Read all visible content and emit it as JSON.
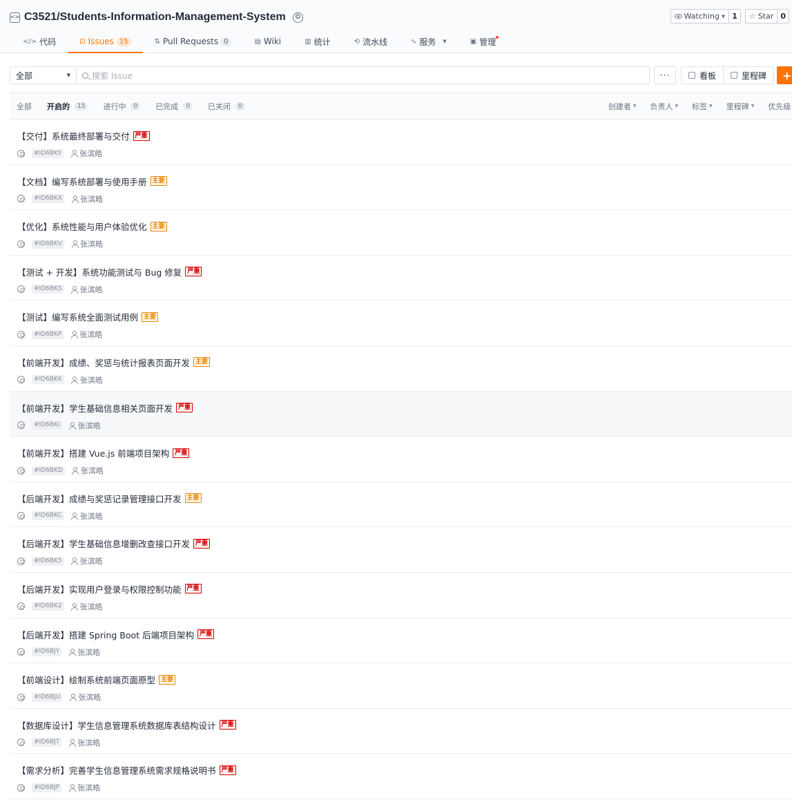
{
  "repo": {
    "title": "C3521/Students-Information-Management-System",
    "repo_icon_glyph": "<>",
    "award_icon_glyph": "✪",
    "watch": {
      "label": "Watching",
      "count": "1"
    },
    "star": {
      "label": "Star",
      "count": "0"
    }
  },
  "tabs": [
    {
      "label": "代码",
      "icon": "code-icon",
      "glyph": "</>"
    },
    {
      "label": "Issues",
      "icon": "issues-icon",
      "glyph": "⊡",
      "count": "15",
      "active": true
    },
    {
      "label": "Pull Requests",
      "icon": "pull-request-icon",
      "glyph": "⇅",
      "count": "0"
    },
    {
      "label": "Wiki",
      "icon": "wiki-icon",
      "glyph": "▤"
    },
    {
      "label": "统计",
      "icon": "stats-icon",
      "glyph": "▥"
    },
    {
      "label": "流水线",
      "icon": "pipeline-icon",
      "glyph": "⟲"
    },
    {
      "label": "服务",
      "icon": "service-icon",
      "glyph": "∿"
    },
    {
      "label": "管理",
      "icon": "manage-icon",
      "glyph": "▣"
    }
  ],
  "filter": {
    "scope": "全部",
    "search_placeholder": "搜索 Issue",
    "more_label": "···",
    "board_label": "看板",
    "milestone_label": "里程碑",
    "new_label": "+"
  },
  "status_tabs": [
    {
      "label": "全部"
    },
    {
      "label": "开启的",
      "count": "15",
      "active": true
    },
    {
      "label": "进行中",
      "count": "0"
    },
    {
      "label": "已完成",
      "count": "0"
    },
    {
      "label": "已关闭",
      "count": "0"
    }
  ],
  "sort_filters": [
    "创建者",
    "负责人",
    "标签",
    "里程碑",
    "优先级"
  ],
  "label_colors": {
    "严重": "#d40000",
    "主要": "#e98600",
    "accent": "#fe7300"
  },
  "issues": [
    {
      "title": "【交付】系统最终部署与交付",
      "label": "严重",
      "id": "#ID6BKY",
      "assignee": "张滨皓"
    },
    {
      "title": "【文档】编写系统部署与使用手册",
      "label": "主要",
      "id": "#ID6BKX",
      "assignee": "张滨皓"
    },
    {
      "title": "【优化】系统性能与用户体验优化",
      "label": "主要",
      "id": "#ID6BKV",
      "assignee": "张滨皓"
    },
    {
      "title": "【测试 + 开发】系统功能测试与 Bug 修复",
      "label": "严重",
      "id": "#ID6BKS",
      "assignee": "张滨皓"
    },
    {
      "title": "【测试】编写系统全面测试用例",
      "label": "主要",
      "id": "#ID6BKP",
      "assignee": "张滨皓"
    },
    {
      "title": "【前端开发】成绩、奖惩与统计报表页面开发",
      "label": "主要",
      "id": "#ID6BKK",
      "assignee": "张滨皓"
    },
    {
      "title": "【前端开发】学生基础信息相关页面开发",
      "label": "严重",
      "id": "#ID6BKI",
      "assignee": "张滨皓"
    },
    {
      "title": "【前端开发】搭建 Vue.js 前端项目架构",
      "label": "严重",
      "id": "#ID6BKD",
      "assignee": "张滨皓"
    },
    {
      "title": "【后端开发】成绩与奖惩记录管理接口开发",
      "label": "主要",
      "id": "#ID6BKC",
      "assignee": "张滨皓"
    },
    {
      "title": "【后端开发】学生基础信息增删改查接口开发",
      "label": "严重",
      "id": "#ID6BK5",
      "assignee": "张滨皓"
    },
    {
      "title": "【后端开发】实现用户登录与权限控制功能",
      "label": "严重",
      "id": "#ID6BK2",
      "assignee": "张滨皓"
    },
    {
      "title": "【后端开发】搭建 Spring Boot 后端项目架构",
      "label": "严重",
      "id": "#ID6BJY",
      "assignee": "张滨皓"
    },
    {
      "title": "【前端设计】绘制系统前端页面原型",
      "label": "主要",
      "id": "#ID6BJU",
      "assignee": "张滨皓"
    },
    {
      "title": "【数据库设计】学生信息管理系统数据库表结构设计",
      "label": "严重",
      "id": "#ID6BJT",
      "assignee": "张滨皓"
    },
    {
      "title": "【需求分析】完善学生信息管理系统需求规格说明书",
      "label": "严重",
      "id": "#ID6BJP",
      "assignee": "张滨皓"
    }
  ]
}
